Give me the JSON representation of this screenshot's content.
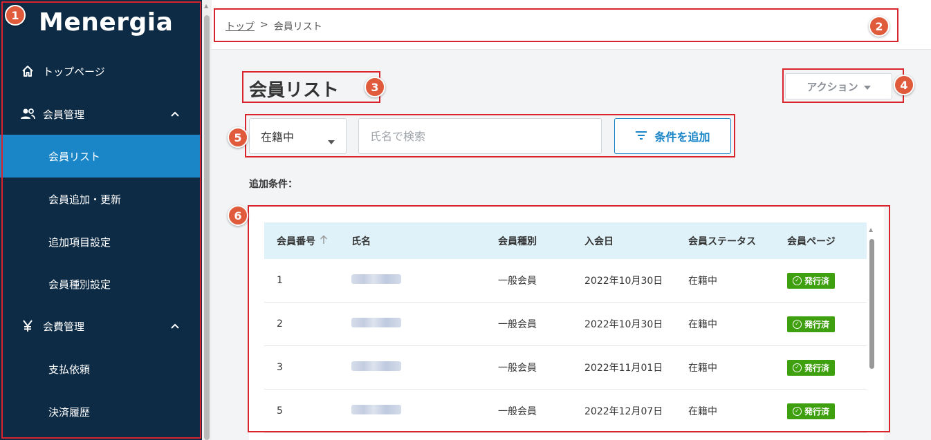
{
  "app": {
    "logo": "Menergia"
  },
  "sidebar": {
    "items": [
      {
        "label": "トップページ",
        "icon": "home-icon"
      },
      {
        "label": "会員管理",
        "icon": "people-icon",
        "expanded": true
      },
      {
        "label": "会員リスト",
        "active": true
      },
      {
        "label": "会員追加・更新"
      },
      {
        "label": "追加項目設定"
      },
      {
        "label": "会員種別設定"
      },
      {
        "label": "会費管理",
        "icon": "yen-icon",
        "expanded": true
      },
      {
        "label": "支払依頼"
      },
      {
        "label": "決済履歴"
      }
    ]
  },
  "breadcrumb": {
    "top": "トップ",
    "separator": ">",
    "current": "会員リスト"
  },
  "page": {
    "title": "会員リスト"
  },
  "actions": {
    "label": "アクション"
  },
  "filters": {
    "status_value": "在籍中",
    "search_placeholder": "氏名で検索",
    "add_condition_label": "条件を追加",
    "conditions_label": "追加条件："
  },
  "table": {
    "columns": [
      "会員番号",
      "氏名",
      "会員種別",
      "入会日",
      "会員ステータス",
      "会員ページ"
    ],
    "rows": [
      {
        "id": "1",
        "type": "一般会員",
        "joined": "2022年10月30日",
        "status": "在籍中",
        "page": "発行済"
      },
      {
        "id": "2",
        "type": "一般会員",
        "joined": "2022年10月30日",
        "status": "在籍中",
        "page": "発行済"
      },
      {
        "id": "3",
        "type": "一般会員",
        "joined": "2022年11月01日",
        "status": "在籍中",
        "page": "発行済"
      },
      {
        "id": "5",
        "type": "一般会員",
        "joined": "2022年12月07日",
        "status": "在籍中",
        "page": "発行済"
      }
    ]
  },
  "annotations": [
    "1",
    "2",
    "3",
    "4",
    "5",
    "6"
  ],
  "colors": {
    "sidebar_bg": "#0d2b45",
    "accent": "#1a86c8",
    "badge": "#3fa00f",
    "annotation": "#d9232d"
  }
}
